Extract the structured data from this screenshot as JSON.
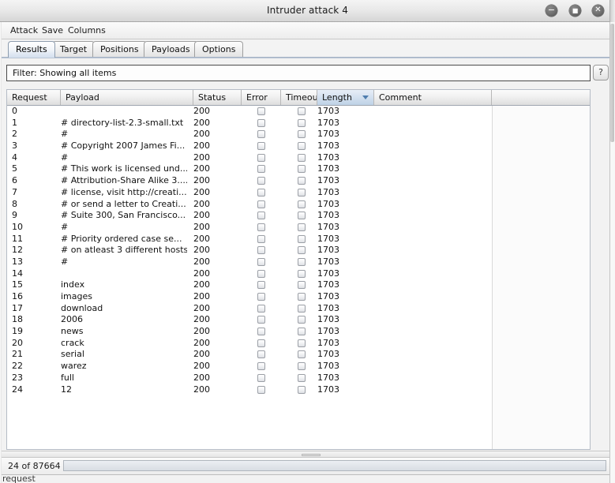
{
  "window": {
    "title": "Intruder attack 4",
    "controls": [
      {
        "name": "minimize-button",
        "glyph": "−"
      },
      {
        "name": "maximize-button",
        "glyph": "■"
      },
      {
        "name": "close-button",
        "glyph": "✕"
      }
    ]
  },
  "menubar": {
    "items": [
      "Attack",
      "Save",
      "Columns"
    ]
  },
  "tabs": [
    {
      "label": "Results",
      "selected": true
    },
    {
      "label": "Target",
      "selected": false
    },
    {
      "label": "Positions",
      "selected": false
    },
    {
      "label": "Payloads",
      "selected": false
    },
    {
      "label": "Options",
      "selected": false
    }
  ],
  "filter": {
    "label_value": "Filter:  Showing all items",
    "help_label": "?"
  },
  "table": {
    "columns": [
      {
        "key": "request",
        "label": "Request",
        "sorted": false
      },
      {
        "key": "payload",
        "label": "Payload",
        "sorted": false
      },
      {
        "key": "status",
        "label": "Status",
        "sorted": false
      },
      {
        "key": "error",
        "label": "Error",
        "sorted": false
      },
      {
        "key": "timeout",
        "label": "Timeout",
        "sorted": false
      },
      {
        "key": "length",
        "label": "Length",
        "sorted": true,
        "sort_direction": "desc"
      },
      {
        "key": "comment",
        "label": "Comment",
        "sorted": false
      }
    ],
    "rows": [
      {
        "request": "0",
        "payload": "",
        "status": "200",
        "error": false,
        "timeout": false,
        "length": "1703",
        "comment": ""
      },
      {
        "request": "1",
        "payload": "# directory-list-2.3-small.txt",
        "status": "200",
        "error": false,
        "timeout": false,
        "length": "1703",
        "comment": ""
      },
      {
        "request": "2",
        "payload": "#",
        "status": "200",
        "error": false,
        "timeout": false,
        "length": "1703",
        "comment": ""
      },
      {
        "request": "3",
        "payload": "# Copyright 2007 James Fi...",
        "status": "200",
        "error": false,
        "timeout": false,
        "length": "1703",
        "comment": ""
      },
      {
        "request": "4",
        "payload": "#",
        "status": "200",
        "error": false,
        "timeout": false,
        "length": "1703",
        "comment": ""
      },
      {
        "request": "5",
        "payload": "# This work is licensed und...",
        "status": "200",
        "error": false,
        "timeout": false,
        "length": "1703",
        "comment": ""
      },
      {
        "request": "6",
        "payload": "# Attribution-Share Alike 3....",
        "status": "200",
        "error": false,
        "timeout": false,
        "length": "1703",
        "comment": ""
      },
      {
        "request": "7",
        "payload": "# license, visit http://creati...",
        "status": "200",
        "error": false,
        "timeout": false,
        "length": "1703",
        "comment": ""
      },
      {
        "request": "8",
        "payload": "# or send a letter to Creati...",
        "status": "200",
        "error": false,
        "timeout": false,
        "length": "1703",
        "comment": ""
      },
      {
        "request": "9",
        "payload": "# Suite 300, San Francisco...",
        "status": "200",
        "error": false,
        "timeout": false,
        "length": "1703",
        "comment": ""
      },
      {
        "request": "10",
        "payload": "#",
        "status": "200",
        "error": false,
        "timeout": false,
        "length": "1703",
        "comment": ""
      },
      {
        "request": "11",
        "payload": "# Priority ordered case se...",
        "status": "200",
        "error": false,
        "timeout": false,
        "length": "1703",
        "comment": ""
      },
      {
        "request": "12",
        "payload": "# on atleast 3 different hosts",
        "status": "200",
        "error": false,
        "timeout": false,
        "length": "1703",
        "comment": ""
      },
      {
        "request": "13",
        "payload": "#",
        "status": "200",
        "error": false,
        "timeout": false,
        "length": "1703",
        "comment": ""
      },
      {
        "request": "14",
        "payload": "",
        "status": "200",
        "error": false,
        "timeout": false,
        "length": "1703",
        "comment": ""
      },
      {
        "request": "15",
        "payload": "index",
        "status": "200",
        "error": false,
        "timeout": false,
        "length": "1703",
        "comment": ""
      },
      {
        "request": "16",
        "payload": "images",
        "status": "200",
        "error": false,
        "timeout": false,
        "length": "1703",
        "comment": ""
      },
      {
        "request": "17",
        "payload": "download",
        "status": "200",
        "error": false,
        "timeout": false,
        "length": "1703",
        "comment": ""
      },
      {
        "request": "18",
        "payload": "2006",
        "status": "200",
        "error": false,
        "timeout": false,
        "length": "1703",
        "comment": ""
      },
      {
        "request": "19",
        "payload": "news",
        "status": "200",
        "error": false,
        "timeout": false,
        "length": "1703",
        "comment": ""
      },
      {
        "request": "20",
        "payload": "crack",
        "status": "200",
        "error": false,
        "timeout": false,
        "length": "1703",
        "comment": ""
      },
      {
        "request": "21",
        "payload": "serial",
        "status": "200",
        "error": false,
        "timeout": false,
        "length": "1703",
        "comment": ""
      },
      {
        "request": "22",
        "payload": "warez",
        "status": "200",
        "error": false,
        "timeout": false,
        "length": "1703",
        "comment": ""
      },
      {
        "request": "23",
        "payload": "full",
        "status": "200",
        "error": false,
        "timeout": false,
        "length": "1703",
        "comment": ""
      },
      {
        "request": "24",
        "payload": "12",
        "status": "200",
        "error": false,
        "timeout": false,
        "length": "1703",
        "comment": ""
      }
    ]
  },
  "statusbar": {
    "count_text": "24 of 87664",
    "progress_percent": 0
  },
  "background_window": {
    "peek_text": "request"
  },
  "colors": {
    "accent": "#4f7dae",
    "sorted_column": "#bed2e6",
    "titlebar": "#e8e8e8",
    "window_button": "#6e6e6e"
  }
}
